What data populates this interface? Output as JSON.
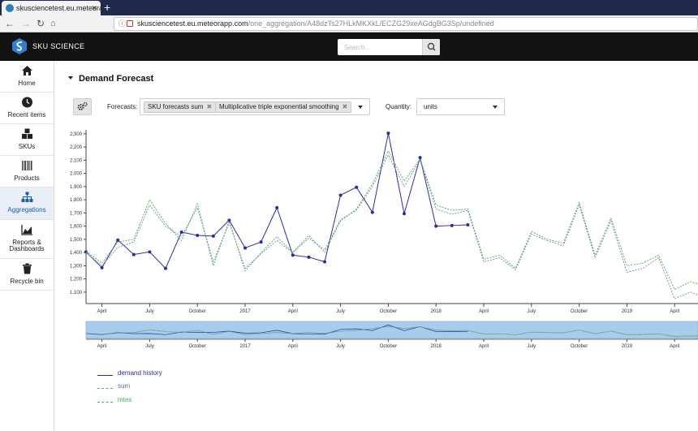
{
  "browser": {
    "tab_title": "skusciencetest.eu.meteorapp.c",
    "url_host": "skusciencetest.eu.meteorapp.com",
    "url_path": "/one_aggregation/A48dzTs27HLkMKXkL/ECZG29xeAGdgBG3Sp/undefined"
  },
  "header": {
    "logo_text": "SKU SCIENCE",
    "search_placeholder": "Search..."
  },
  "sidebar": {
    "items": [
      {
        "label": "Home",
        "icon": "home-icon"
      },
      {
        "label": "Recent items",
        "icon": "clock-icon"
      },
      {
        "label": "SKUs",
        "icon": "cubes-icon"
      },
      {
        "label": "Products",
        "icon": "barcode-icon"
      },
      {
        "label": "Aggregations",
        "icon": "sitemap-icon",
        "active": true
      },
      {
        "label": "Reports &\nDashboards",
        "icon": "area-chart-icon"
      },
      {
        "label": "Recycle bin",
        "icon": "trash-icon"
      }
    ]
  },
  "main": {
    "section_title": "Demand Forecast",
    "forecasts_label": "Forecasts:",
    "forecast_chips": [
      "SKU forecasts sum",
      "Multiplicative triple exponential smoothing"
    ],
    "quantity_label": "Quantity:",
    "quantity_value": "units"
  },
  "colors": {
    "history": "#2b2aa6",
    "sum": "#7f86a6",
    "mtes": "#3fb34f",
    "active_sidebar": "#1a5fb4",
    "header_bg": "#121212",
    "navigator_fill": "#a9ccec"
  },
  "chart_data": {
    "type": "line",
    "x_labels": [
      "April",
      "July",
      "October",
      "2017",
      "April",
      "July",
      "October",
      "2018",
      "April",
      "July",
      "October",
      "2019",
      "April"
    ],
    "y_ticks": [
      "1,100",
      "1,200",
      "1,300",
      "1,400",
      "1,500",
      "1,600",
      "1,700",
      "1,800",
      "1,900",
      "2,000",
      "2,100",
      "2,200",
      "2,300"
    ],
    "ylim": [
      1050,
      2330
    ],
    "grid": false,
    "legend_placement": "bottom-left",
    "series": [
      {
        "name": "demand history",
        "style": "solid",
        "markers": true,
        "values": [
          1405,
          1285,
          1495,
          1385,
          1405,
          1280,
          1555,
          1530,
          1525,
          1645,
          1435,
          1480,
          1740,
          1380,
          1365,
          1330,
          1835,
          1895,
          1705,
          2305,
          1695,
          2120,
          1600,
          1605,
          1610
        ]
      },
      {
        "name": "sum",
        "style": "dashed",
        "markers": false,
        "values": [
          1400,
          1300,
          1440,
          1480,
          1760,
          1600,
          1520,
          1740,
          1330,
          1625,
          1280,
          1390,
          1490,
          1400,
          1510,
          1420,
          1650,
          1720,
          1900,
          2140,
          1900,
          2100,
          1730,
          1690,
          1720,
          1330,
          1360,
          1270,
          1540,
          1490,
          1450,
          1760,
          1360,
          1640,
          1250,
          1280,
          1360,
          1050,
          1100,
          1050
        ]
      },
      {
        "name": "mtes",
        "style": "dashed",
        "markers": false,
        "values": [
          1410,
          1320,
          1480,
          1500,
          1800,
          1620,
          1490,
          1770,
          1300,
          1640,
          1260,
          1400,
          1520,
          1400,
          1530,
          1400,
          1640,
          1730,
          1920,
          2170,
          1940,
          2110,
          1760,
          1720,
          1730,
          1350,
          1380,
          1280,
          1560,
          1500,
          1470,
          1780,
          1380,
          1660,
          1300,
          1320,
          1380,
          1120,
          1180,
          1140
        ]
      }
    ]
  }
}
